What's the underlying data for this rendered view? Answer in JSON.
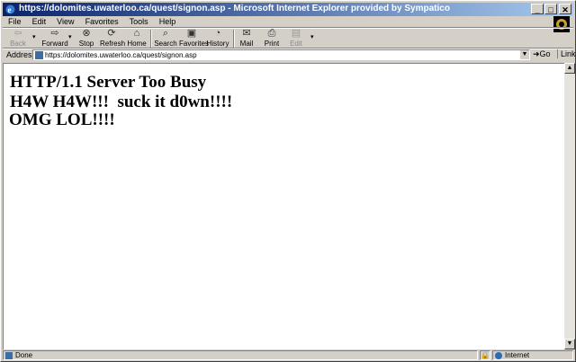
{
  "window": {
    "title": "https://dolomites.uwaterloo.ca/quest/signon.asp - Microsoft Internet Explorer provided by Sympatico",
    "controls": {
      "minimize": "_",
      "maximize": "□",
      "close": "✕"
    }
  },
  "menu": {
    "file": "File",
    "edit": "Edit",
    "view": "View",
    "favorites": "Favorites",
    "tools": "Tools",
    "help": "Help"
  },
  "toolbar": {
    "back": "Back",
    "forward": "Forward",
    "stop": "Stop",
    "refresh": "Refresh",
    "home": "Home",
    "search": "Search",
    "favorites": "Favorites",
    "history": "History",
    "mail": "Mail",
    "print": "Print",
    "edit": "Edit"
  },
  "address": {
    "label": "Address",
    "url": "https://dolomites.uwaterloo.ca/quest/signon.asp",
    "go": "Go",
    "links": "Links"
  },
  "content": {
    "line1": "HTTP/1.1 Server Too Busy",
    "line2": "H4W H4W!!!  suck it d0wn!!!!",
    "line3": "OMG LOL!!!!"
  },
  "status": {
    "text": "Done",
    "zone": "Internet"
  }
}
